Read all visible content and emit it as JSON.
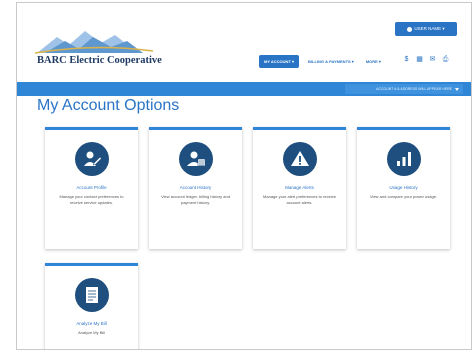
{
  "header": {
    "logo_text": "BARC Electric Cooperative",
    "user_button_label": "USER NAME ▾"
  },
  "nav": {
    "items": [
      {
        "label": "MY ACCOUNT ▾",
        "active": true
      },
      {
        "label": "BILLING & PAYMENTS ▾",
        "active": false
      },
      {
        "label": "MORE ▾",
        "active": false
      }
    ],
    "icons": [
      "dollar-icon",
      "calendar-icon",
      "mail-icon",
      "print-icon"
    ]
  },
  "account_bar": {
    "selected_account": "ACCOUNT # & ADDRESS WILL APPEAR HERE"
  },
  "page": {
    "title": "My Account Options"
  },
  "cards": [
    {
      "title": "Account Profile",
      "description": "Manage your contact preferences to receive service updates.",
      "icon": "pencil-user-icon"
    },
    {
      "title": "Account History",
      "description": "View account ledger, billing history and payment history.",
      "icon": "user-list-icon"
    },
    {
      "title": "Manage Alerts",
      "description": "Manage your alert preferences to receive account alerts.",
      "icon": "warning-icon"
    },
    {
      "title": "Usage History",
      "description": "View and compare your power usage.",
      "icon": "bar-chart-icon"
    },
    {
      "title": "Analyze My Bill",
      "description": "Analyze My Bill",
      "icon": "bill-icon"
    }
  ],
  "colors": {
    "brand_blue": "#2a74c6",
    "bar_blue": "#2f86d6",
    "icon_circle": "#1f4f7f"
  }
}
